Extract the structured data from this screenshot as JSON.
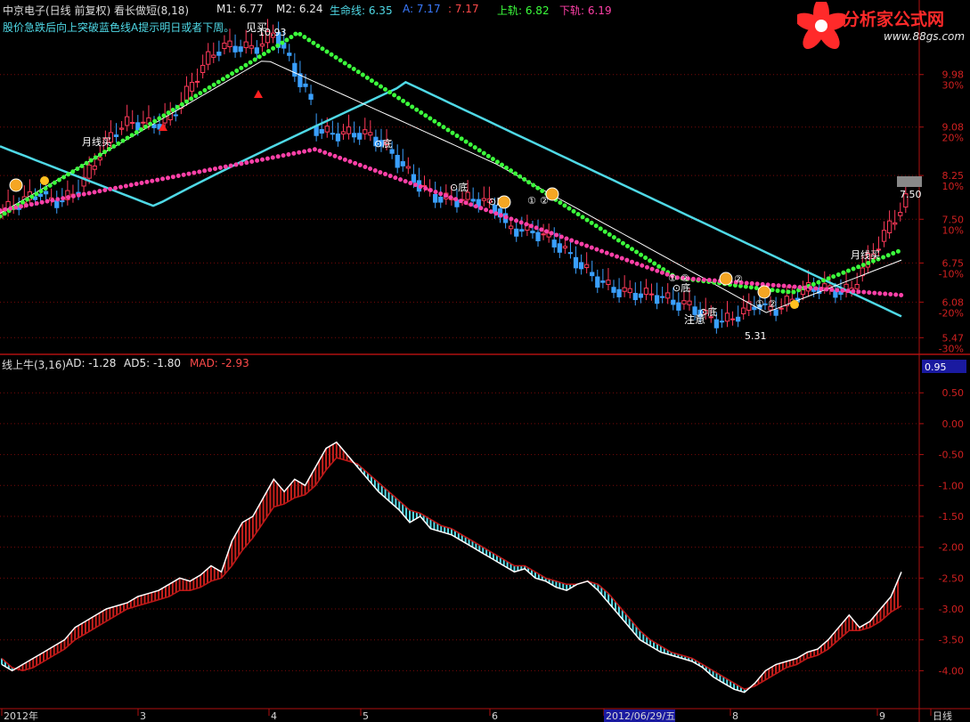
{
  "header": {
    "title": "中京电子(日线 前复权) 看长做短(8,18)",
    "m1": "M1: 6.77",
    "m2": "M2: 6.24",
    "life": "生命线: 6.35",
    "a": "A: 7.17",
    "a2": ": 7.17",
    "upper": "上轨: 6.82",
    "lower": "下轨: 6.19",
    "hint": "股价急跌后向上突破蓝色线A提示明日或者下周。",
    "hint_tail": "见买"
  },
  "logo": {
    "title": "分析家公式网",
    "url": "www.88gs.com"
  },
  "colors": {
    "up": "#ff3a5a",
    "down": "#3aa0ff",
    "cyan": "#4fd9e6",
    "green": "#3cff3c",
    "pink": "#ff40a8",
    "white": "#ffffff",
    "navy": "#2a2acc",
    "red_bar": "#c8201c",
    "cyan_bar": "#58dce8"
  },
  "chart_data": [
    {
      "type": "candlestick",
      "title": "中京电子(日线 前复权)",
      "y_ticks": [
        9.98,
        9.08,
        8.25,
        7.5,
        6.75,
        6.08,
        5.47
      ],
      "pct_ticks": [
        "30%",
        "20%",
        "10%",
        "10%",
        "-10%",
        "-20%",
        "-30%"
      ],
      "ylim": [
        5.2,
        10.8
      ],
      "annotations": [
        "10.93",
        "5.31",
        "7.50",
        "底",
        "注意",
        "月线买",
        "①",
        "②"
      ],
      "series": [
        {
          "name": "M1",
          "value": 6.77
        },
        {
          "name": "M2",
          "value": 6.24
        },
        {
          "name": "生命线",
          "value": 6.35
        },
        {
          "name": "A",
          "value": 7.17
        },
        {
          "name": "上轨",
          "value": 6.82
        },
        {
          "name": "下轨",
          "value": 6.19
        }
      ]
    },
    {
      "type": "area",
      "title": "线上牛(3,16)",
      "labels": {
        "ad": "AD: -1.28",
        "ad5": "AD5: -1.80",
        "mad": "MAD: -2.93",
        "ind": "线上牛(3,16)"
      },
      "current": "0.95",
      "y_ticks": [
        "0.50",
        "0.00",
        "-0.50",
        "-1.00",
        "-1.50",
        "-2.00",
        "-2.50",
        "-3.00",
        "-3.50",
        "-4.00"
      ],
      "ylim": [
        -4.6,
        0.95
      ],
      "x_labels": [
        "2012年",
        "3",
        "4",
        "5",
        "6",
        "2012/06/29/五",
        "8",
        "9",
        "日线"
      ],
      "ad_values": [
        -3.9,
        -4.0,
        -3.9,
        -3.8,
        -3.7,
        -3.6,
        -3.5,
        -3.3,
        -3.2,
        -3.1,
        -3.0,
        -2.95,
        -2.9,
        -2.8,
        -2.75,
        -2.7,
        -2.6,
        -2.5,
        -2.55,
        -2.45,
        -2.3,
        -2.4,
        -1.9,
        -1.6,
        -1.5,
        -1.2,
        -0.9,
        -1.1,
        -0.9,
        -1.0,
        -0.7,
        -0.4,
        -0.3,
        -0.5,
        -0.7,
        -0.9,
        -1.1,
        -1.25,
        -1.4,
        -1.6,
        -1.5,
        -1.7,
        -1.75,
        -1.8,
        -1.9,
        -2.0,
        -2.1,
        -2.2,
        -2.3,
        -2.4,
        -2.35,
        -2.5,
        -2.55,
        -2.65,
        -2.7,
        -2.6,
        -2.55,
        -2.7,
        -2.9,
        -3.1,
        -3.3,
        -3.5,
        -3.6,
        -3.7,
        -3.75,
        -3.8,
        -3.85,
        -3.95,
        -4.1,
        -4.2,
        -4.3,
        -4.35,
        -4.2,
        -4.0,
        -3.9,
        -3.85,
        -3.8,
        -3.7,
        -3.65,
        -3.5,
        -3.3,
        -3.1,
        -3.3,
        -3.2,
        -3.0,
        -2.8,
        -2.4
      ],
      "mad_values": [
        -3.8,
        -3.95,
        -4.0,
        -3.95,
        -3.85,
        -3.75,
        -3.65,
        -3.5,
        -3.4,
        -3.3,
        -3.2,
        -3.1,
        -3.0,
        -2.95,
        -2.9,
        -2.85,
        -2.8,
        -2.7,
        -2.7,
        -2.65,
        -2.55,
        -2.5,
        -2.3,
        -2.05,
        -1.85,
        -1.6,
        -1.35,
        -1.3,
        -1.2,
        -1.15,
        -1.0,
        -0.75,
        -0.55,
        -0.6,
        -0.65,
        -0.8,
        -0.95,
        -1.1,
        -1.25,
        -1.4,
        -1.45,
        -1.55,
        -1.65,
        -1.7,
        -1.8,
        -1.9,
        -2.0,
        -2.1,
        -2.2,
        -2.3,
        -2.3,
        -2.4,
        -2.5,
        -2.55,
        -2.6,
        -2.6,
        -2.55,
        -2.6,
        -2.75,
        -2.95,
        -3.15,
        -3.35,
        -3.5,
        -3.6,
        -3.7,
        -3.75,
        -3.8,
        -3.9,
        -4.0,
        -4.1,
        -4.2,
        -4.3,
        -4.25,
        -4.15,
        -4.05,
        -3.95,
        -3.9,
        -3.8,
        -3.75,
        -3.65,
        -3.5,
        -3.35,
        -3.35,
        -3.3,
        -3.2,
        -3.05,
        -2.95
      ]
    }
  ]
}
